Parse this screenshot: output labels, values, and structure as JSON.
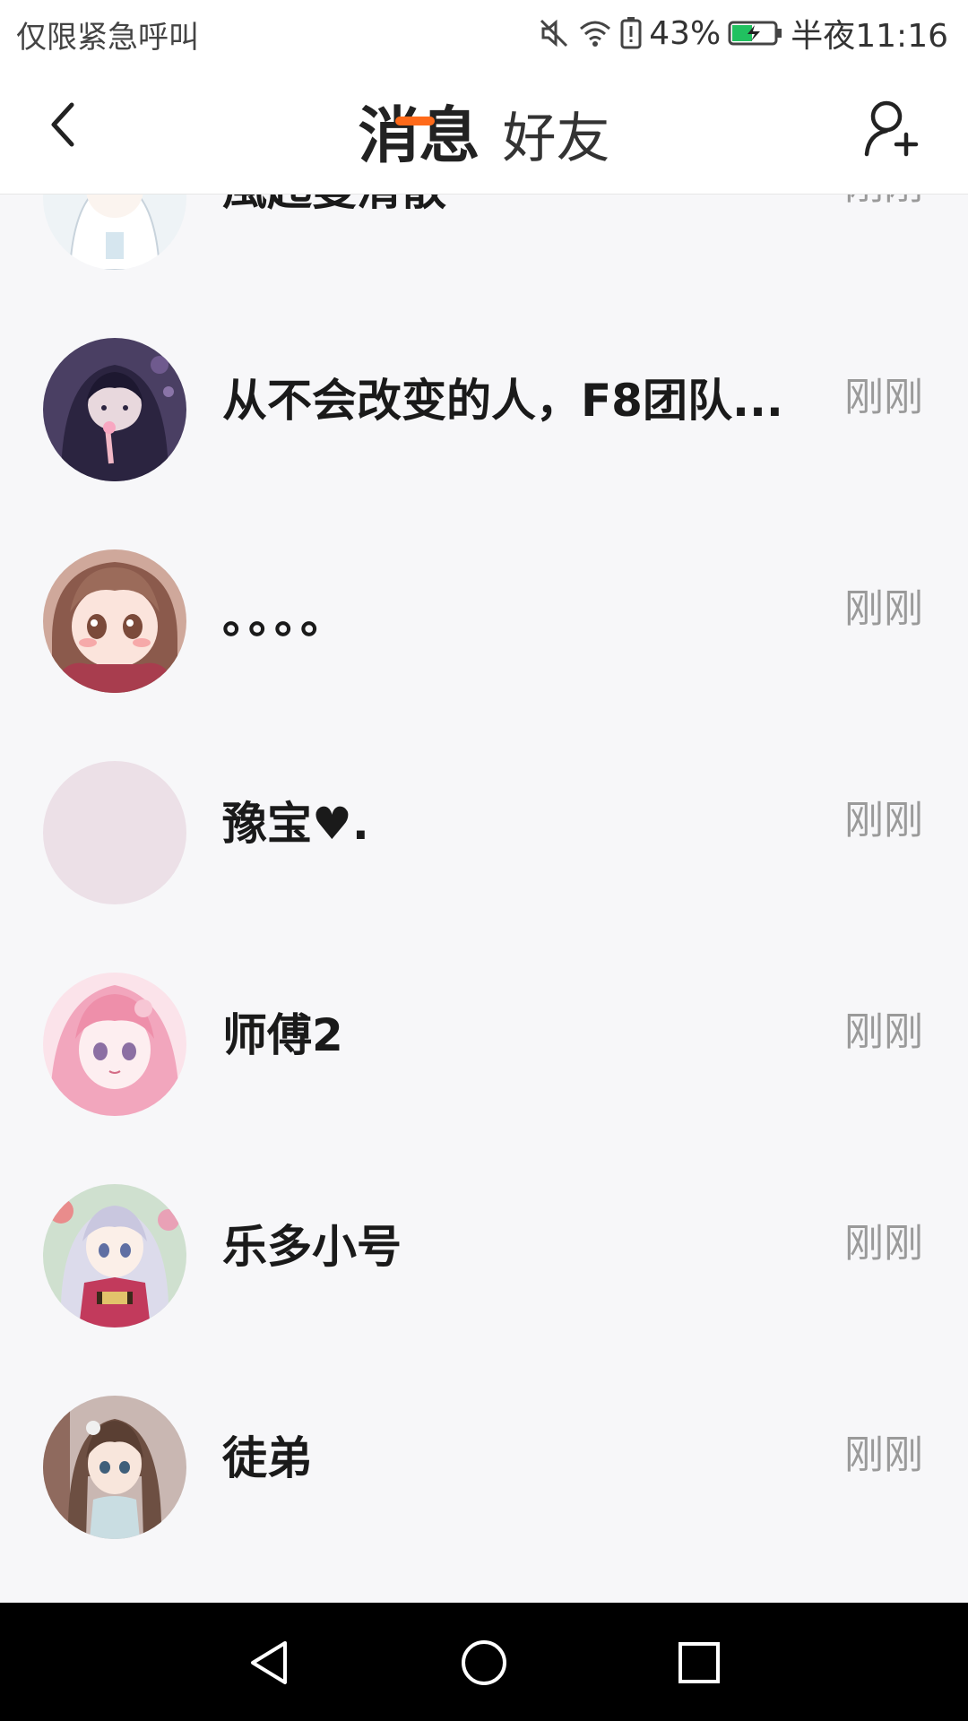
{
  "status_bar": {
    "carrier_text": "仅限紧急呼叫",
    "battery_percent": "43%",
    "time": "半夜11:16",
    "icons": [
      "mute-icon",
      "wifi-icon",
      "battery-alert-icon",
      "battery-charging-icon"
    ],
    "battery_color": "#21c160"
  },
  "header": {
    "tabs": [
      {
        "label": "消息",
        "active": true
      },
      {
        "label": "好友",
        "active": false
      }
    ],
    "accent_color": "#ff6a1a",
    "back_icon": "chevron-left-icon",
    "add_icon": "add-user-icon"
  },
  "conversations": [
    {
      "name": "風起曼清散",
      "time": "刚刚",
      "avatar": "anime-avatar-white-hair"
    },
    {
      "name": "从不会改变的人，F8团队...",
      "time": "刚刚",
      "avatar": "anime-avatar-hooded-boy"
    },
    {
      "name": "。。。。",
      "time": "刚刚",
      "avatar": "anime-avatar-brown-hair-girl"
    },
    {
      "name": "豫宝♥.",
      "time": "刚刚",
      "avatar": "blank-avatar"
    },
    {
      "name": "师傅2",
      "time": "刚刚",
      "avatar": "anime-avatar-pink-hair"
    },
    {
      "name": "乐多小号",
      "time": "刚刚",
      "avatar": "anime-avatar-silver-hair-girl"
    },
    {
      "name": "徒弟",
      "time": "刚刚",
      "avatar": "anime-avatar-long-brown-hair"
    }
  ],
  "nav_bar": {
    "icons": [
      "nav-back-icon",
      "nav-home-icon",
      "nav-recents-icon"
    ]
  }
}
